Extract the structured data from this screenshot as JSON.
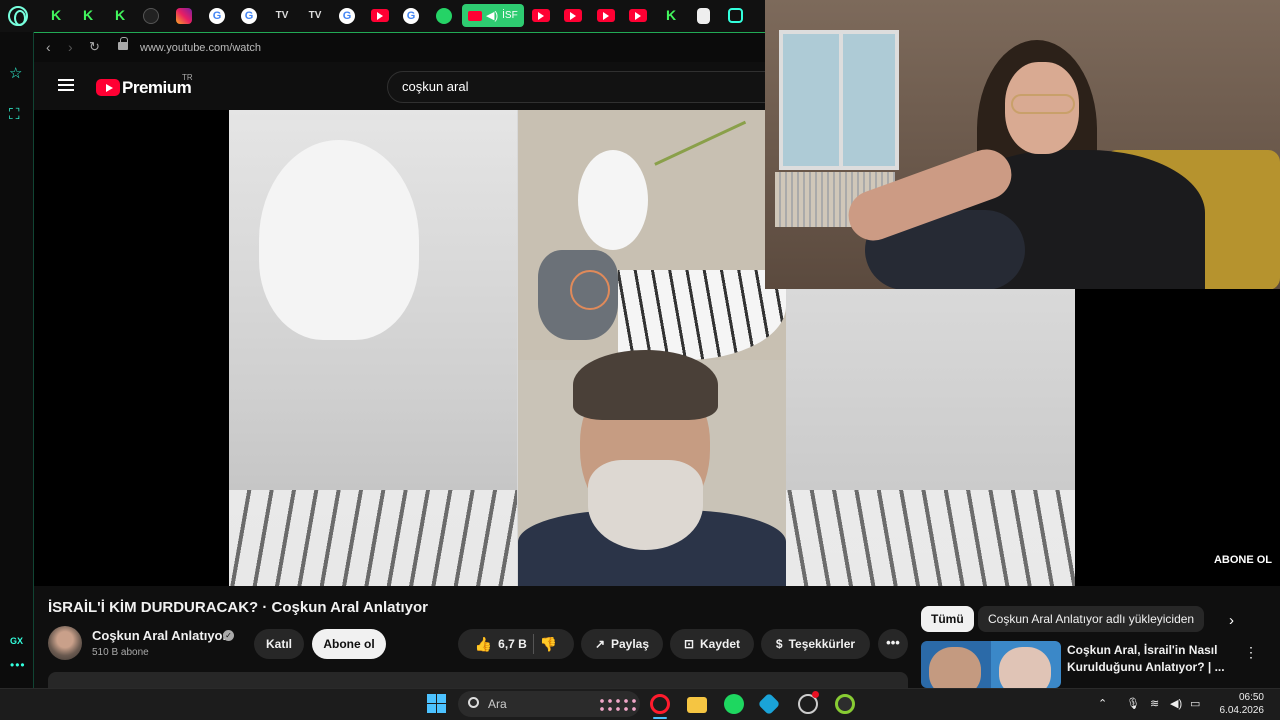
{
  "browser": {
    "url": "www.youtube.com/watch",
    "active_tab_label": "İSF",
    "sidebar_label": "GX"
  },
  "youtube": {
    "brand": "Premium",
    "region": "TR",
    "search_value": "coşkun aral",
    "video": {
      "title": "İSRAİL'İ KİM DURDURACAK? · Coşkun Aral Anlatıyor",
      "watermark": "ABONE OL"
    },
    "channel": {
      "name": "Coşkun Aral Anlatıyor",
      "subscribers": "510 B abone"
    },
    "actions": {
      "join": "Katıl",
      "subscribe": "Abone ol",
      "likes": "6,7 B",
      "share": "Paylaş",
      "save": "Kaydet",
      "thanks": "Teşekkürler"
    },
    "filter_chips": [
      "Tümü",
      "Coşkun Aral Anlatıyor adlı yükleyiciden"
    ],
    "recommendation": {
      "title": "Coşkun Aral, İsrail'in Nasıl Kurulduğunu Anlatıyor? | ..."
    }
  },
  "taskbar": {
    "search_label": "Ara",
    "time": "06:50",
    "date": "6.04.2026"
  },
  "colors": {
    "youtube_red": "#ff0033",
    "opera_gx_accent": "#33ffdd",
    "active_tab_green": "#2ecc71"
  }
}
